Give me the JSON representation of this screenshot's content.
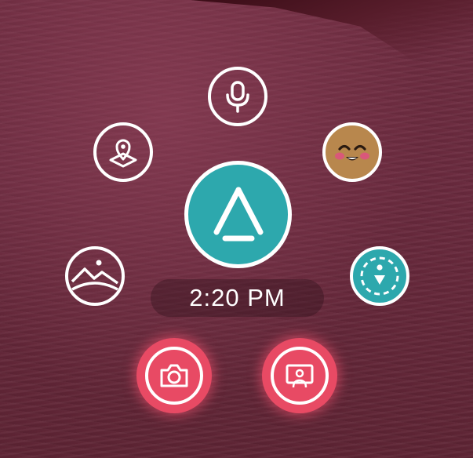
{
  "clock": {
    "time": "2:20 PM"
  },
  "menu": {
    "items": [
      {
        "id": "voice",
        "icon": "microphone-icon"
      },
      {
        "id": "places",
        "icon": "map-pin-icon"
      },
      {
        "id": "emoji",
        "icon": "emoji-face-icon"
      },
      {
        "id": "home",
        "icon": "home-triangle-icon"
      },
      {
        "id": "media",
        "icon": "landscape-icon"
      },
      {
        "id": "teleport",
        "icon": "teleport-icon"
      },
      {
        "id": "camera",
        "icon": "camera-icon"
      },
      {
        "id": "share",
        "icon": "screen-share-icon"
      }
    ]
  },
  "colors": {
    "accent": "#2da8ad",
    "capture": "#e84a64",
    "emoji_face": "#b8874d",
    "emoji_cheek": "#d9587a"
  }
}
